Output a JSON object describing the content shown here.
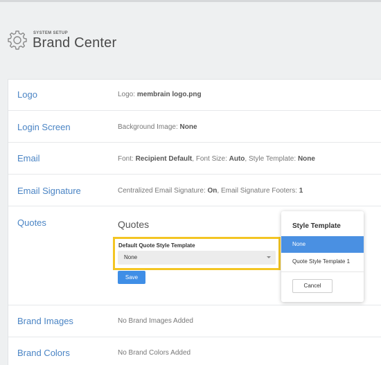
{
  "header": {
    "supertitle": "SYSTEM SETUP",
    "title": "Brand Center"
  },
  "rows": {
    "logo": {
      "label": "Logo",
      "prefix": "Logo: ",
      "filename": "membrain logo.png"
    },
    "login": {
      "label": "Login Screen",
      "prefix": "Background Image: ",
      "value": "None"
    },
    "email": {
      "label": "Email",
      "font_label": "Font: ",
      "font_value": "Recipient Default",
      "size_label": ", Font Size: ",
      "size_value": "Auto",
      "template_label": ", Style Template: ",
      "template_value": "None"
    },
    "signature": {
      "label": "Email Signature",
      "central_label": "Centralized Email Signature: ",
      "central_value": "On",
      "footers_label": ", Email Signature Footers: ",
      "footers_value": "1"
    },
    "quotes": {
      "label": "Quotes",
      "section_title": "Quotes",
      "field_label": "Default Quote Style Template",
      "field_value": "None",
      "save_label": "Save"
    },
    "brand_images": {
      "label": "Brand Images",
      "value": "No Brand Images Added"
    },
    "brand_colors": {
      "label": "Brand Colors",
      "value": "No Brand Colors Added"
    }
  },
  "popup": {
    "title": "Style Template",
    "options": [
      "None",
      "Quote Style Template 1"
    ],
    "selected": "None",
    "cancel_label": "Cancel"
  },
  "colors": {
    "link": "#4a84c4",
    "highlight_border": "#f3c523",
    "primary_button": "#3f8ee6",
    "selected_option": "#4a90e2"
  },
  "icons": {
    "header": "gear-icon",
    "dropdown": "chevron-down-icon"
  }
}
